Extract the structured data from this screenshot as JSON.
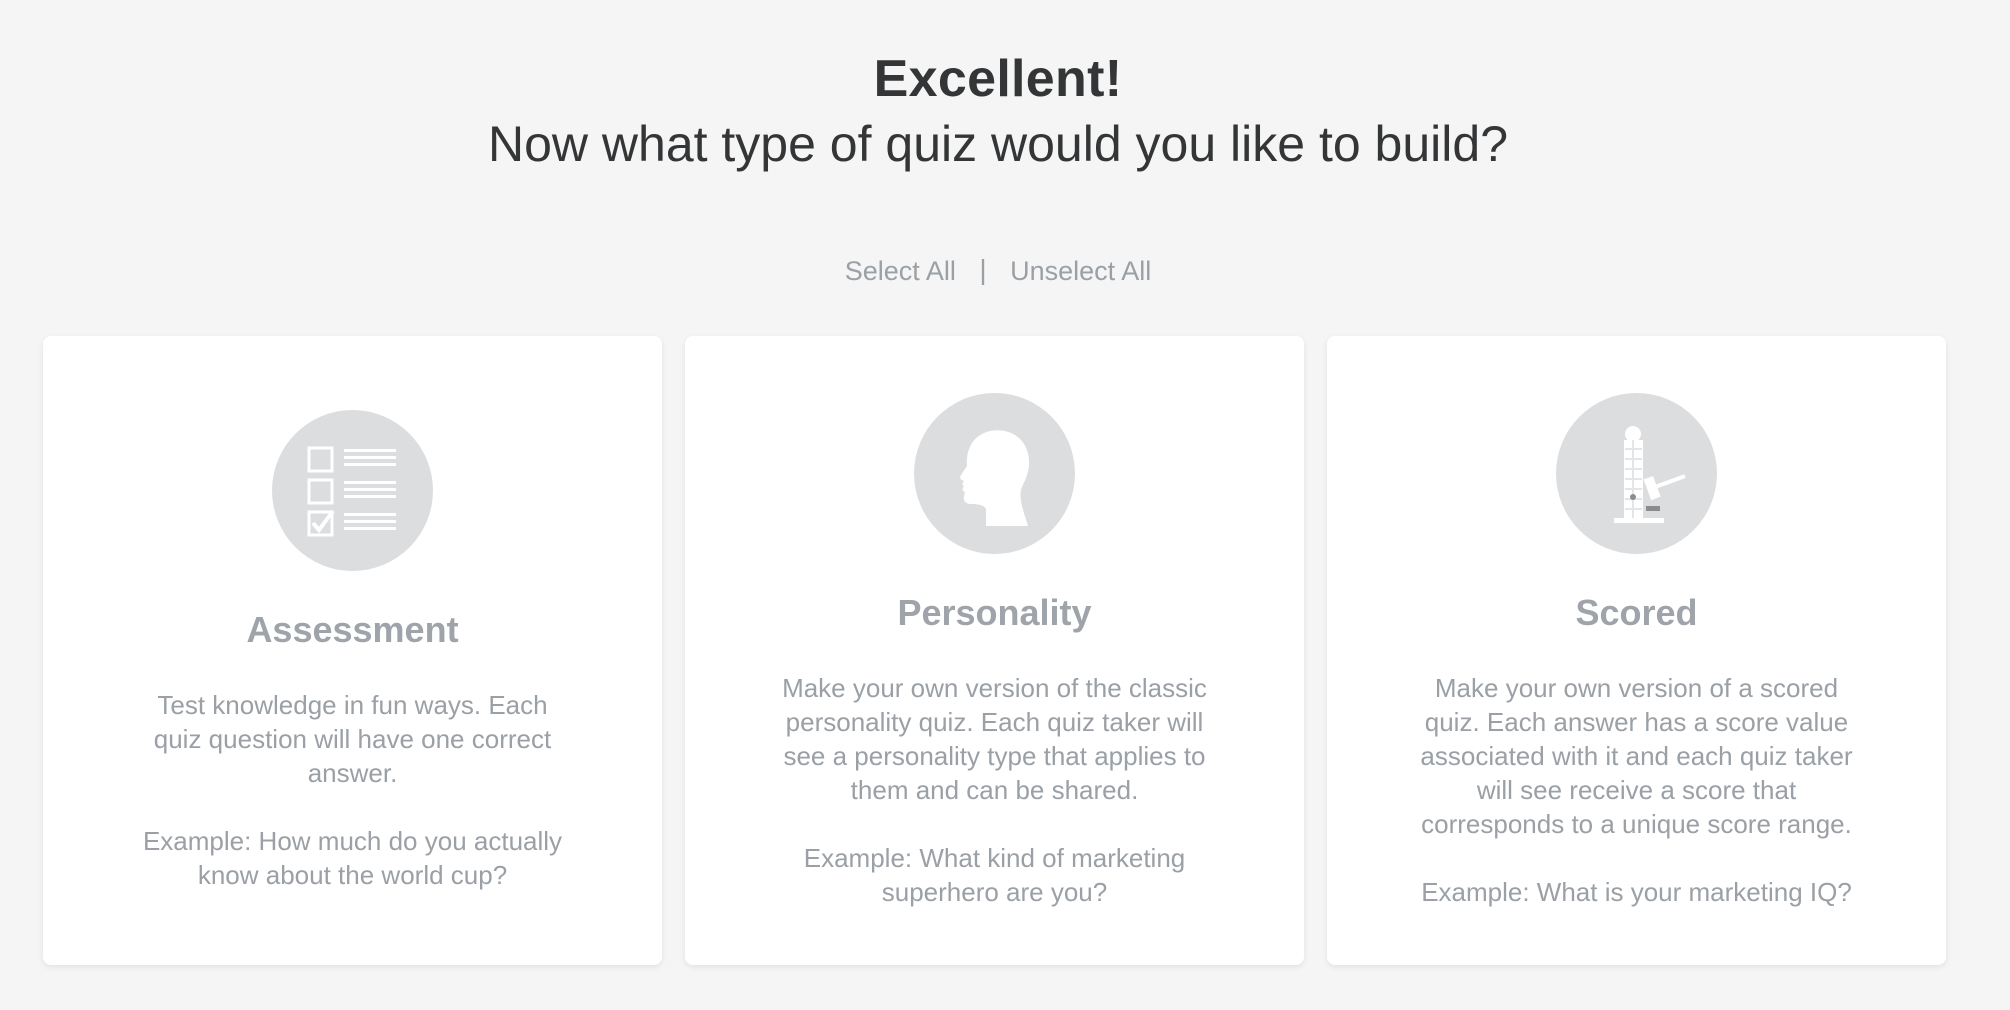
{
  "header": {
    "title": "Excellent!",
    "subtitle": "Now what type of quiz would you like to build?"
  },
  "selection": {
    "select_all": "Select All",
    "separator": "|",
    "unselect_all": "Unselect All"
  },
  "quiz_types": [
    {
      "icon": "checklist-icon",
      "title": "Assessment",
      "description": "Test knowledge in fun ways. Each quiz question will have one correct answer.",
      "example": "Example: How much do you actually know about the world cup?"
    },
    {
      "icon": "head-profile-icon",
      "title": "Personality",
      "description": "Make your own version of the classic personality quiz. Each quiz taker will see a personality type that applies to them and can be shared.",
      "example": "Example: What kind of marketing superhero are you?"
    },
    {
      "icon": "strength-tester-icon",
      "title": "Scored",
      "description": "Make your own version of a scored quiz. Each answer has a score value associated with it and each quiz taker will see receive a score that corresponds to a unique score range.",
      "example": "Example: What is your marketing IQ?"
    }
  ],
  "colors": {
    "background": "#f4f5f4",
    "heading": "#333537",
    "muted_text": "#9aa0a5",
    "icon_circle": "#dcdddf"
  }
}
